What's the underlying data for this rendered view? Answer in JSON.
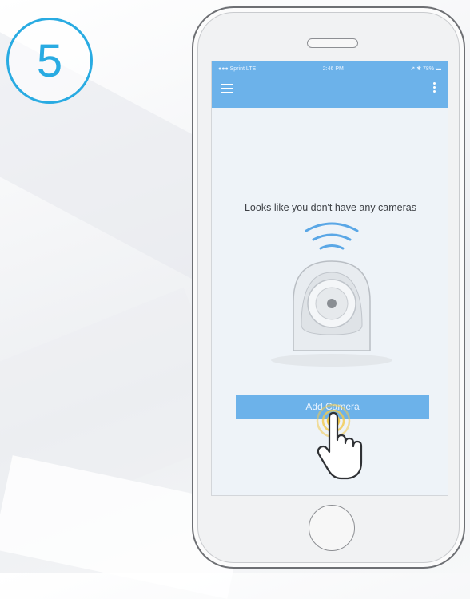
{
  "step": {
    "number": "5",
    "color": "#29abe2"
  },
  "status_bar": {
    "carrier": "●●● Sprint  LTE",
    "time": "2:46 PM",
    "battery": "↗ ✱ 78% ▬"
  },
  "nav_bar": {
    "menu_icon": "hamburger-menu-icon",
    "more_icon": "vertical-dots-icon",
    "color": "#6cb2ea"
  },
  "empty_state": {
    "message": "Looks like you don't have any cameras",
    "illustration": "pan-tilt-camera-with-wifi-signal"
  },
  "add_camera": {
    "label": "Add Camera"
  },
  "gesture": {
    "icon": "tap-hand-icon",
    "ripple_color": "#f2c94c"
  }
}
